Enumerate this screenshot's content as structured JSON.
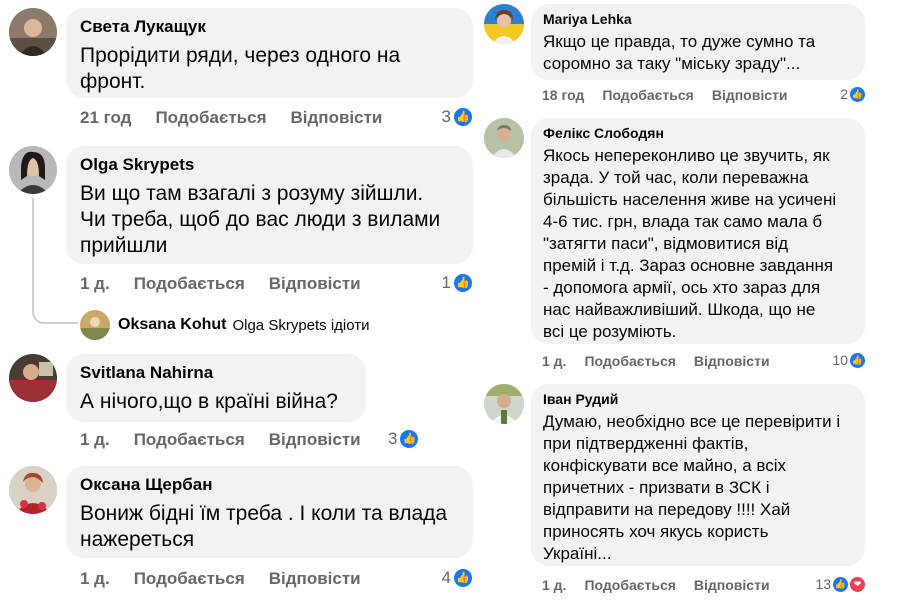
{
  "left_comments": [
    {
      "author": "Света Лукащук",
      "text": "Прорідити ряди, через одного на\nфронт.",
      "time": "21 год",
      "like_label": "Подобається",
      "reply_label": "Відповісти",
      "likes": "3",
      "avatar_icon": "avatar-photo-icon"
    },
    {
      "author": "Olga Skrypets",
      "text": "Ви  що там взагалі з розуму зійшли.\nЧи треба, щоб до вас  люди з вилами\nприйшли",
      "time": "1 д.",
      "like_label": "Подобається",
      "reply_label": "Відповісти",
      "likes": "1",
      "avatar_icon": "avatar-photo-icon",
      "reply": {
        "author": "Oksana Kohut",
        "text": "Olga Skrypets ідіоти"
      }
    },
    {
      "author": "Svitlana Nahirna",
      "text": "А нічого,що в країні війна?",
      "time": "1 д.",
      "like_label": "Подобається",
      "reply_label": "Відповісти",
      "likes": "3",
      "avatar_icon": "avatar-photo-icon"
    },
    {
      "author": "Оксана Щербан",
      "text": "Вониж бідні їм треба . І коли та влада\nнажереться",
      "time": "1 д.",
      "like_label": "Подобається",
      "reply_label": "Відповісти",
      "likes": "4",
      "avatar_icon": "avatar-photo-icon"
    }
  ],
  "right_comments": [
    {
      "author": "Mariya Lehka",
      "text": "Якщо це правда, то дуже сумно та\nсоромно за таку \"міську зраду\"...",
      "time": "18 год",
      "like_label": "Подобається",
      "reply_label": "Відповісти",
      "likes": "2",
      "avatar_icon": "avatar-photo-icon"
    },
    {
      "author": "Фелікс Слободян",
      "text": "Якось непереконливо це звучить, як\nзрада. У той час, коли переважна\nбільшість населення живе на усичені\n4-6 тис. грн, влада так само мала б\n\"затягти паси\", відмовитися від\nпремій і т.д. Зараз основне завдання\n- допомога армії, ось хто зараз для\nнас найважливіший. Шкода, що не\nвсі це розуміють.",
      "time": "1 д.",
      "like_label": "Подобається",
      "reply_label": "Відповісти",
      "likes": "10",
      "avatar_icon": "avatar-photo-icon"
    },
    {
      "author": "Іван Рудий",
      "text": "Думаю, необхідно все це перевірити і\nпри підтвердженні фактів,\nконфіскувати все майно, а всіх\nпричетних - призвати в ЗСК і\nвідправити на передову !!!! Хай\nприносять хоч якусь користь\nУкраїні...",
      "time": "1 д.",
      "like_label": "Подобається",
      "reply_label": "Відповісти",
      "likes": "13",
      "avatar_icon": "avatar-photo-icon"
    }
  ],
  "icons": {
    "like": "thumbs-up-icon",
    "love": "heart-icon"
  },
  "colors": {
    "like_blue": "#1877f2",
    "love_red": "#f33e58",
    "bubble_bg": "#f0f2f5",
    "meta_gray": "#65676b"
  }
}
